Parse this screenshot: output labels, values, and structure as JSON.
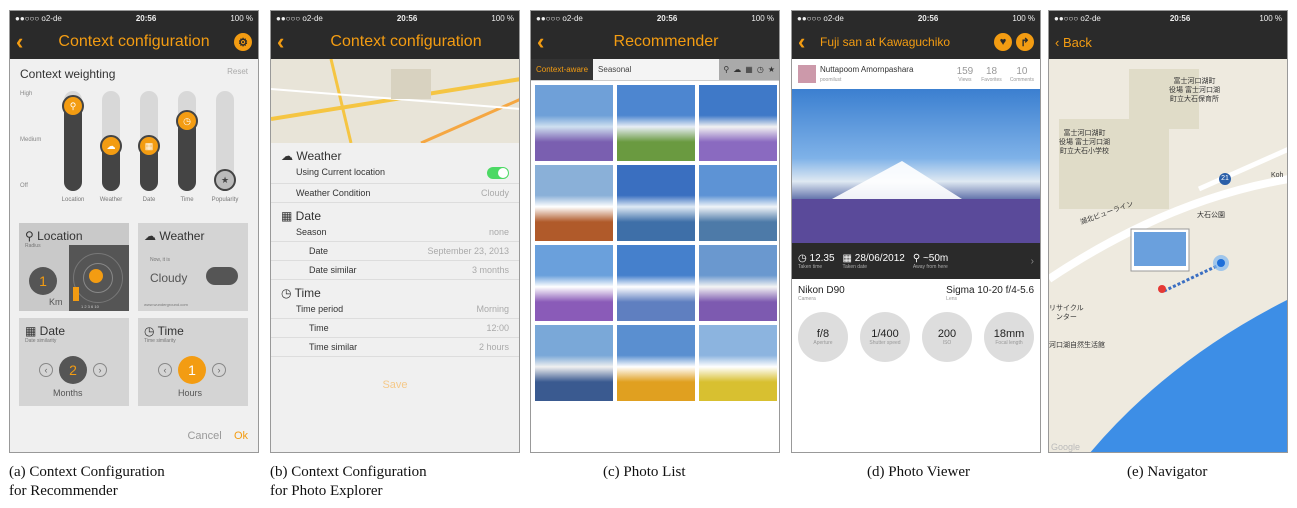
{
  "status": {
    "carrier": "●●○○○ o2-de",
    "time": "20:56",
    "battery": "100 %"
  },
  "screen_a": {
    "title": "Context configuration",
    "section": "Context weighting",
    "reset": "Reset",
    "levels": [
      "High",
      "Medium",
      "Off"
    ],
    "sliders": [
      {
        "label": "Location",
        "icon": "location-pin-icon",
        "value": 0.85
      },
      {
        "label": "Weather",
        "icon": "weather-icon",
        "value": 0.45
      },
      {
        "label": "Date",
        "icon": "calendar-icon",
        "value": 0.45
      },
      {
        "label": "Time",
        "icon": "clock-icon",
        "value": 0.7
      },
      {
        "label": "Popularity",
        "icon": "star-icon",
        "value": 0.05
      }
    ],
    "location": {
      "title": "Location",
      "radius_label": "Radius",
      "value": "1",
      "unit": "Km",
      "scale": "1 2 3 6 10"
    },
    "weather": {
      "title": "Weather",
      "now_label": "Now, it is",
      "value": "Cloudy",
      "source": "www.wunderground.com"
    },
    "date": {
      "title": "Date",
      "sim_label": "Date similarity",
      "value": "2",
      "unit": "Months"
    },
    "time": {
      "title": "Time",
      "sim_label": "Time similarity",
      "value": "1",
      "unit": "Hours"
    },
    "cancel": "Cancel",
    "ok": "Ok"
  },
  "screen_b": {
    "title": "Context configuration",
    "weather": {
      "title": "Weather",
      "use_loc": "Using Current location",
      "cond_label": "Weather Condition",
      "cond_value": "Cloudy"
    },
    "date": {
      "title": "Date",
      "season_label": "Season",
      "season_value": "none",
      "date_label": "Date",
      "date_value": "September 23, 2013",
      "sim_label": "Date similar",
      "sim_value": "3 months"
    },
    "time": {
      "title": "Time",
      "period_label": "Time period",
      "period_value": "Morning",
      "time_label": "Time",
      "time_value": "12:00",
      "sim_label": "Time similar",
      "sim_value": "2 hours"
    },
    "save": "Save"
  },
  "screen_c": {
    "title": "Recommender",
    "tab1": "Context-aware",
    "tab2": "Seasonal"
  },
  "screen_d": {
    "title": "Fuji san at Kawaguchiko",
    "user": "Nuttapoom Amornpashara",
    "handle": "poomilust",
    "views": "159",
    "views_label": "Views",
    "favs": "18",
    "favs_label": "Favorites",
    "comments": "10",
    "comments_label": "Comments",
    "taken_time": "12.35",
    "taken_time_label": "Taken time",
    "taken_date": "28/06/2012",
    "taken_date_label": "Taken date",
    "dist": "~50m",
    "dist_label": "Away from here",
    "camera": "Nikon D90",
    "camera_label": "Camera",
    "lens": "Sigma 10-20 f/4-5.6",
    "lens_label": "Lens",
    "aperture": "f/8",
    "aperture_label": "Aperture",
    "shutter": "1/400",
    "shutter_label": "Shutter speed",
    "iso": "200",
    "iso_label": "ISO",
    "focal": "18mm",
    "focal_label": "Focal length"
  },
  "screen_e": {
    "back": "Back",
    "labels": [
      "富士河口湖町\n役場 富士河口湖\n町立大石保育所",
      "富士河口湖町\n役場 富士河口湖\n町立大石小学校",
      "大石公園",
      "リサイクル\nンター",
      "河口湖自然生活館",
      "湖北ビューライン",
      "Koh",
      "21"
    ],
    "google": "Google"
  },
  "captions": {
    "a": "(a) Context Configuration\nfor Recommender",
    "b": "(b) Context Configuration\nfor Photo Explorer",
    "c": "(c) Photo List",
    "d": "(d) Photo Viewer",
    "e": "(e) Navigator"
  }
}
